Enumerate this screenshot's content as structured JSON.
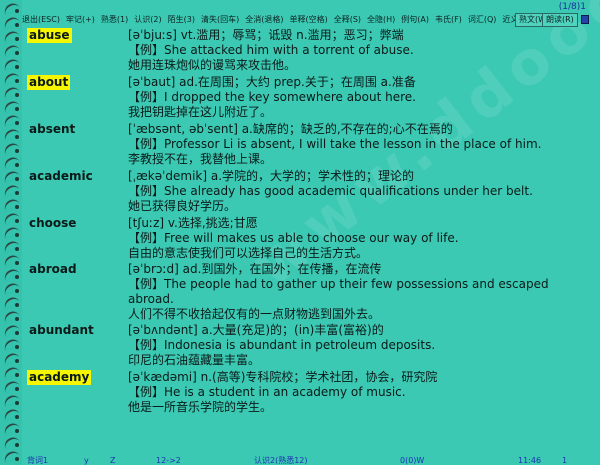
{
  "pager": "(1/8)1",
  "menu": {
    "items": [
      "退出(ESC)",
      "牢记(+)",
      "熟悉(1)",
      "认识(2)",
      "陌生(3)",
      "清失(回车)",
      "全消(退格)",
      "单释(空格)",
      "全释(S)",
      "全隐(H)",
      "例句(A)",
      "韦氏(F)",
      "词汇(Q)",
      "近义(C)"
    ],
    "trailing": [
      "熟文(W)",
      "朗读(R)"
    ]
  },
  "entries": [
    {
      "word": "abuse",
      "highlight": true,
      "definition": "[əˈbjuːs] vt.滥用；辱骂；诋毁 n.滥用；恶习；弊端",
      "example": "【例】She attacked him with a torrent of abuse.",
      "translation": "她用连珠炮似的谩骂来攻击他。"
    },
    {
      "word": "about",
      "highlight": true,
      "definition": "[əˈbaut] ad.在周围；大约 prep.关于；在周围 a.准备",
      "example": "【例】I dropped the key somewhere about here.",
      "translation": "我把钥匙掉在这儿附近了。"
    },
    {
      "word": "absent",
      "highlight": false,
      "definition": "[ˈæbsənt, əbˈsent] a.缺席的；缺乏的,不存在的;心不在焉的",
      "example": "【例】Professor Li is absent, I will take the lesson in the place of him.",
      "translation": "李教授不在，我替他上课。"
    },
    {
      "word": "academic",
      "highlight": false,
      "definition": "[ˌækəˈdemik] a.学院的，大学的；学术性的；理论的",
      "example": "【例】She already has good academic qualifications under her belt.",
      "translation": "她已获得良好学历。"
    },
    {
      "word": "choose",
      "highlight": false,
      "definition": "[tʃuːz] v.选择,挑选;甘愿",
      "example": "【例】Free will makes us able to choose our way of life.",
      "translation": "自由的意志使我们可以选择自己的生活方式。"
    },
    {
      "word": "abroad",
      "highlight": false,
      "definition": "[əˈbrɔːd] ad.到国外，在国外；在传播，在流传",
      "example": "【例】The people had to gather up their few possessions and escaped abroad.",
      "translation": "人们不得不收拾起仅有的一点财物逃到国外去。"
    },
    {
      "word": "abundant",
      "highlight": false,
      "definition": "[əˈbʌndənt] a.大量(充足)的；(in)丰富(富裕)的",
      "example": "【例】Indonesia is abundant in petroleum deposits.",
      "translation": "印尼的石油蕴藏量丰富。"
    },
    {
      "word": "academy",
      "highlight": true,
      "definition": "[əˈkædəmi] n.(高等)专科院校；学术社团，协会，研究院",
      "example": "【例】He is a student in an academy of music.",
      "translation": "他是一所音乐学院的学生。"
    }
  ],
  "status": {
    "s1": "背词1",
    "s2": "y",
    "s3": "Z",
    "s4": "12->2",
    "s5": "认识2(熟悉12)",
    "s6": "0(0)W",
    "s7": "11:46",
    "s8": "1"
  },
  "colors": {
    "background": "#3cc9b4",
    "highlight": "#f6f600",
    "status_text": "#1b35b0"
  }
}
